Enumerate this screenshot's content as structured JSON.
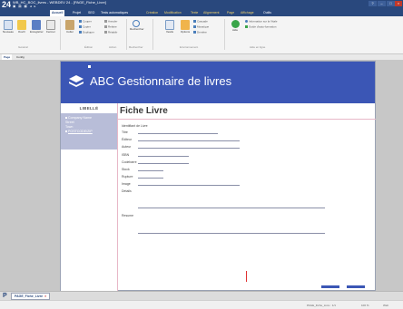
{
  "titlebar": {
    "app_logo": "24",
    "title": "WB_HC_BOC_livres - WEBDEV 24 - [PAGE_Fiche_Livre]",
    "help_badge": "?"
  },
  "ribbon_tabs": [
    "Accueil",
    "Projet",
    "SEO",
    "Tests automatiques",
    "Création",
    "Modification",
    "Texte",
    "Alignement",
    "Page",
    "Affichage",
    "Outils"
  ],
  "ribbon": {
    "buttons": [
      "Nouveau",
      "Ouvrir",
      "Enregistrer",
      "Fermer",
      "Coller",
      "Rechercher",
      "Vestis",
      "Options",
      "Aide"
    ],
    "small_commands": [
      "Couper",
      "Copier",
      "Dupliquer",
      "Annuler",
      "Refaire",
      "Rétablir",
      "Fenêtre",
      "Cascade",
      "Mosaïque",
      "Derrière",
      "Information sur la Vitale",
      "Guide d'auto-formation"
    ],
    "groups": [
      "Général",
      "Édition",
      "Action",
      "Rechercher",
      "Environnement",
      "Aide en ligne"
    ]
  },
  "page_tabs": [
    "Page",
    "Config"
  ],
  "header": {
    "title": "ABC Gestionnaire de livres"
  },
  "sidebar": {
    "heading": "LIBELLÉ",
    "links": [
      "Company Name",
      "Street",
      "Town",
      "POSTCODE/ZIP"
    ]
  },
  "content": {
    "title": "Fiche Livre",
    "fields": [
      "Identifiant de Livre",
      "Titre",
      "Éditeur",
      "Auteur",
      "ISBN",
      "Codebarre",
      "Stock",
      "Rupture",
      "Image",
      "Details",
      "Resume"
    ]
  },
  "doc_tabs": {
    "icon": "P",
    "active": "PAGE_Fiche_Livre",
    "close": "×"
  },
  "statusbar": {
    "items": [
      "PAGE_Fiche_Livre : 1/1",
      "100 %",
      "Web"
    ]
  },
  "colors": {
    "accent": "#29487d",
    "header": "#3b56b5",
    "sidebar_panel": "#b8bdd8"
  }
}
